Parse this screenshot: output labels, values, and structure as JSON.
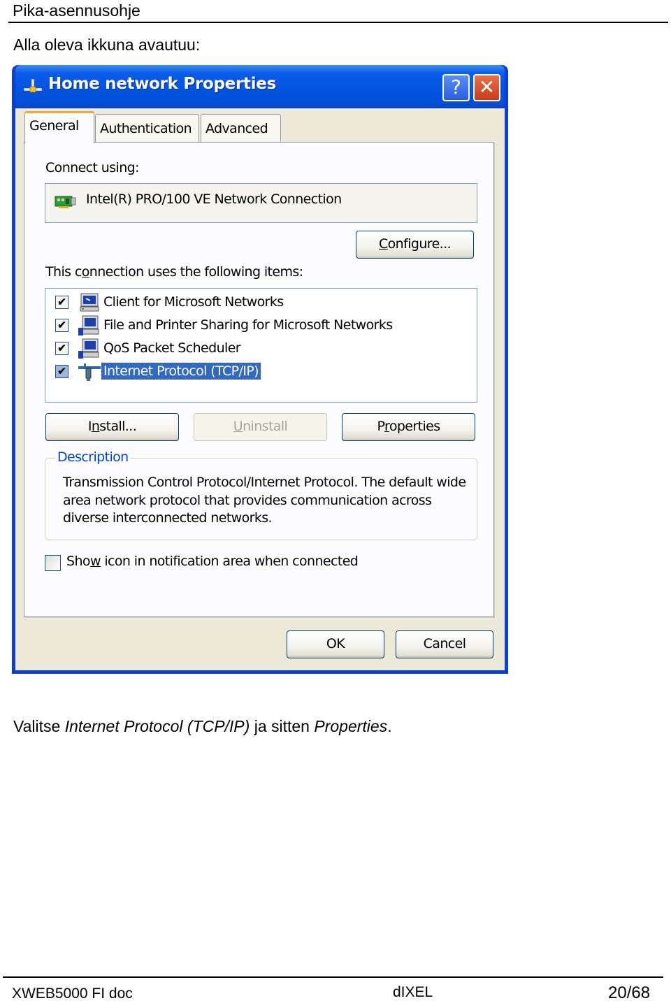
{
  "document": {
    "header": "Pika-asennusohje",
    "intro": "Alla oleva ikkuna avautuu:",
    "caption": {
      "part1": "Valitse ",
      "part2_italic": "Internet Protocol (TCP/IP)",
      "part3": " ja sitten ",
      "part4_italic": "Properties",
      "part5": "."
    },
    "footer": {
      "left": "XWEB5000 FI doc",
      "center": "dIXEL",
      "right": "20/68"
    }
  },
  "dialog": {
    "title": "Home network Properties",
    "title_icon": "network-connection-icon",
    "help_button": "?",
    "close_button": "✕",
    "tabs": [
      {
        "label": "General",
        "active": true
      },
      {
        "label": "Authentication",
        "active": false
      },
      {
        "label": "Advanced",
        "active": false
      }
    ],
    "connect_using_label": "Connect using:",
    "adapter": {
      "icon": "network-card-icon",
      "name": "Intel(R) PRO/100 VE Network Connection"
    },
    "configure_button": {
      "pre": "",
      "accel": "C",
      "post": "onfigure..."
    },
    "items_label": {
      "pre": "This c",
      "accel": "o",
      "post": "nnection uses the following items:"
    },
    "items": [
      {
        "label": "Client for Microsoft Networks",
        "checked": true,
        "selected": false,
        "icon": "client-computer-icon"
      },
      {
        "label": "File and Printer Sharing for Microsoft Networks",
        "checked": true,
        "selected": false,
        "icon": "shared-computer-icon"
      },
      {
        "label": "QoS Packet Scheduler",
        "checked": true,
        "selected": false,
        "icon": "service-computer-icon"
      },
      {
        "label": "Internet Protocol (TCP/IP)",
        "checked": true,
        "selected": true,
        "icon": "protocol-icon"
      }
    ],
    "install_button": {
      "pre": "I",
      "accel": "n",
      "post": "stall..."
    },
    "uninstall_button": {
      "pre": "",
      "accel": "U",
      "post": "ninstall",
      "disabled": true
    },
    "properties_button": {
      "pre": "P",
      "accel": "r",
      "post": "operties"
    },
    "description": {
      "legend": "Description",
      "text": "Transmission Control Protocol/Internet Protocol. The default wide area network protocol that provides communication across diverse interconnected networks."
    },
    "show_icon": {
      "pre": "Sho",
      "accel": "w",
      "post": " icon in notification area when connected",
      "checked": false
    },
    "ok_button": "OK",
    "cancel_button": "Cancel",
    "colors": {
      "titlebar": "#0454e3",
      "selection": "#316ac5",
      "face": "#ece9d8",
      "tab_highlight": "#f5a731",
      "legend": "#0046d5"
    }
  }
}
